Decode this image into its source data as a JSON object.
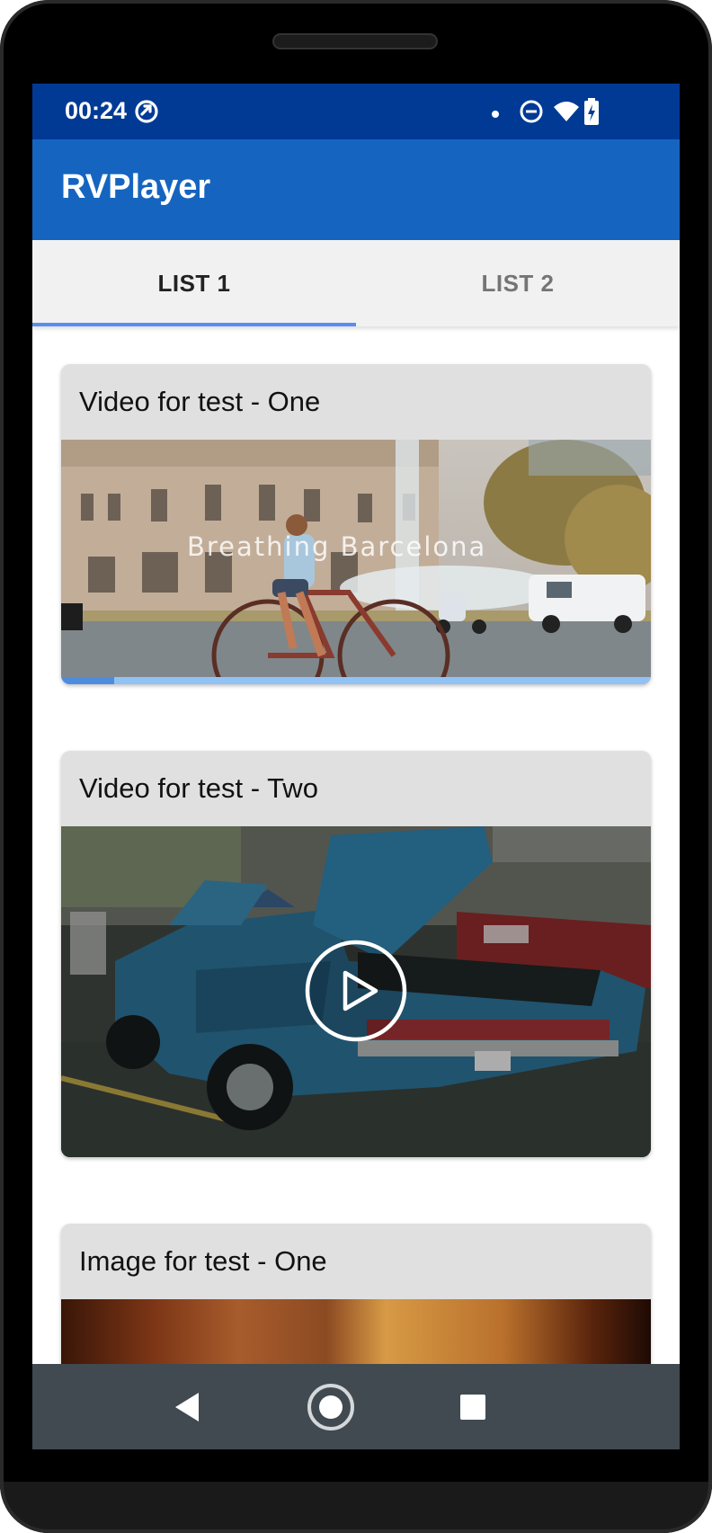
{
  "status_bar": {
    "time": "00:24",
    "icons": [
      "sync-icon",
      "notification-dot-icon",
      "do-not-disturb-icon",
      "wifi-icon",
      "battery-charging-icon"
    ]
  },
  "app_bar": {
    "title": "RVPlayer"
  },
  "tabs": {
    "items": [
      {
        "label": "LIST 1",
        "selected": true
      },
      {
        "label": "LIST 2",
        "selected": false
      }
    ]
  },
  "cards": [
    {
      "title": "Video for test - One",
      "media_type": "video",
      "state": "playing",
      "overlay_text": "Breathing Barcelona",
      "progress_fraction": 0.09
    },
    {
      "title": "Video for test - Two",
      "media_type": "video",
      "state": "paused",
      "play_icon": "play-circle-icon"
    },
    {
      "title": "Image for test - One",
      "media_type": "image"
    }
  ],
  "nav_bar": {
    "buttons": [
      "back-icon",
      "home-icon",
      "recents-icon"
    ]
  },
  "colors": {
    "status_bar": "#003a95",
    "app_bar": "#1565c0",
    "tab_indicator": "#5b8def",
    "progress": "#4c8de0",
    "card_header": "#e0e0e0",
    "nav_bar": "#414a50"
  }
}
